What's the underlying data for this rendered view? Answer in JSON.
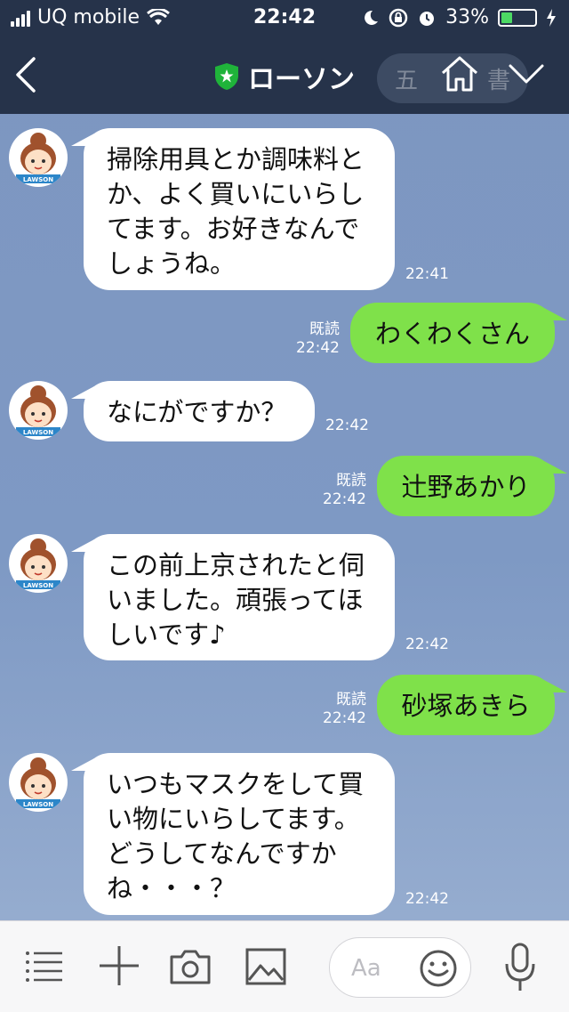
{
  "status_bar": {
    "carrier": "UQ mobile",
    "time": "22:42",
    "battery_percent": "33%",
    "battery_level": 0.33
  },
  "header": {
    "title": "ローソン",
    "background_ghost_text": "五　　　書",
    "icons": [
      "back-icon",
      "verified-shield-icon",
      "home-icon",
      "chevron-down-icon"
    ]
  },
  "chat": {
    "messages": [
      {
        "side": "in",
        "lines": [
          "掃除用具とか調味料と",
          "か、よく買いにいらし",
          "てます。お好きなんで",
          "しょうね。"
        ],
        "time": "22:41"
      },
      {
        "side": "out",
        "text": "わくわくさん",
        "read": "既読",
        "time": "22:42"
      },
      {
        "side": "in",
        "lines": [
          "なにがですか？"
        ],
        "time": "22:42"
      },
      {
        "side": "out",
        "text": "辻野あかり",
        "read": "既読",
        "time": "22:42"
      },
      {
        "side": "in",
        "lines": [
          "この前上京されたと伺",
          "いました。頑張ってほ",
          "しいです♪"
        ],
        "time": "22:42"
      },
      {
        "side": "out",
        "text": "砂塚あきら",
        "read": "既読",
        "time": "22:42"
      },
      {
        "side": "in",
        "lines": [
          "いつもマスクをして買",
          "い物にいらしてます。",
          "どうしてなんですか",
          "ね・・・？"
        ],
        "time": "22:42"
      }
    ],
    "avatar_label": "LAWSON"
  },
  "input_bar": {
    "placeholder": "Aa",
    "icons": [
      "menu-icon",
      "plus-icon",
      "camera-icon",
      "image-icon",
      "emoji-icon",
      "microphone-icon"
    ]
  },
  "colors": {
    "header_bg": "#26334a",
    "chat_bg": "#7e99c4",
    "outgoing_bubble": "#7fe14a",
    "incoming_bubble": "#ffffff",
    "shield": "#1fb33a"
  }
}
